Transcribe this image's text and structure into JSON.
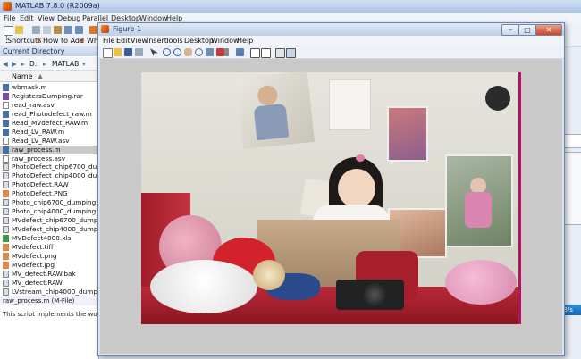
{
  "matlab": {
    "title": "MATLAB 7.8.0 (R2009a)",
    "menu": [
      "File",
      "Edit",
      "View",
      "Debug",
      "Parallel",
      "Desktop",
      "Window",
      "Help"
    ],
    "shortcuts": {
      "label": "Shortcuts",
      "how_to_add": "How to Add",
      "whats_new_partial": "Wha"
    },
    "current_directory": {
      "header": "Current Directory",
      "path_drive": "D:",
      "path_folder": "MATLAB",
      "column_name": "Name",
      "files": [
        "wbmask.m",
        "RegistersDumping.rar",
        "read_raw.asv",
        "read_Photodefect_raw.m",
        "Read_MVdefect_RAW.m",
        "Read_LV_RAW.m",
        "Read_LV_RAW.asv",
        "raw_process.m",
        "raw_process.asv",
        "PhotoDefect_chip6700_dumpi...",
        "PhotoDefect_chip4000_dumpi...",
        "PhotoDefect.RAW",
        "PhotoDefect.PNG",
        "Photo_chip6700_dumping.RAW",
        "Photo_chip4000_dumping.RAW",
        "MVdefect_chip6700_dumping...",
        "MVdefect_chip4000_dumping...",
        "MVDefect4000.xls",
        "MVdefect.tiff",
        "MVdefect.png",
        "MVdefect.jpg",
        "MV_defect.RAW.bak",
        "MV_defect.RAW",
        "LVstream_chip4000_dumping..."
      ],
      "selected_index": 7,
      "details_header": "raw_process.m (M-File)",
      "details_text": "This script implements the workflo"
    },
    "edge_button": "OKB/s"
  },
  "figure": {
    "title": "Figure 1",
    "menu": [
      "File",
      "Edit",
      "View",
      "Insert",
      "Tools",
      "Desktop",
      "Window",
      "Help"
    ],
    "minimize": "–",
    "maximize": "□",
    "close": "✕"
  },
  "colors": {
    "title_bar": "#bcd0e8",
    "selection": "#c9c9c9",
    "figure_bg": "#c9c9c9",
    "accent_button": "#1769b3"
  }
}
